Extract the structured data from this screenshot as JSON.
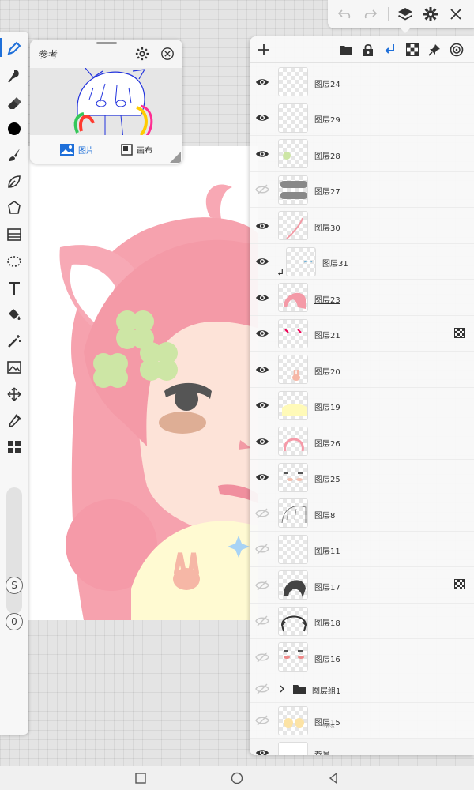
{
  "reference": {
    "title": "参考",
    "tab_image": "图片",
    "tab_canvas": "画布"
  },
  "colors": {
    "accent": "#1e6fd9",
    "eye_visible": "#333333",
    "eye_hidden": "#c8c8c8",
    "current_color": "#000000"
  },
  "toolbar": {
    "tools": [
      "pen-icon",
      "smudge-icon",
      "eraser-icon",
      "color-swatch",
      "brush-icon",
      "leaf-brush-icon",
      "shape-icon",
      "filter-icon",
      "lasso-icon",
      "text-icon",
      "fill-icon",
      "magic-wand-icon",
      "image-adjust-icon",
      "transform-icon",
      "eyedropper-icon",
      "grid-icon"
    ],
    "size_button": "S",
    "opacity_button": "0"
  },
  "layers": [
    {
      "name": "图层24",
      "visible": true
    },
    {
      "name": "图层29",
      "visible": true
    },
    {
      "name": "图层28",
      "visible": true
    },
    {
      "name": "图层27",
      "visible": false
    },
    {
      "name": "图层30",
      "visible": true
    },
    {
      "name": "图层31",
      "visible": true,
      "clipped": true
    },
    {
      "name": "图层23",
      "visible": true,
      "selected": true
    },
    {
      "name": "图层21",
      "visible": true,
      "alpha_lock": true
    },
    {
      "name": "图层20",
      "visible": true
    },
    {
      "name": "图层19",
      "visible": true
    },
    {
      "name": "图层26",
      "visible": true
    },
    {
      "name": "图层25",
      "visible": true
    },
    {
      "name": "图层8",
      "visible": false
    },
    {
      "name": "图层11",
      "visible": false
    },
    {
      "name": "图层17",
      "visible": false,
      "alpha_lock": true
    },
    {
      "name": "图层18",
      "visible": false
    },
    {
      "name": "图层16",
      "visible": false
    },
    {
      "name": "图层组1",
      "visible": false,
      "group": true
    },
    {
      "name": "图层15",
      "visible": false,
      "sub": "56%"
    },
    {
      "name": "背景",
      "visible": true,
      "background": true
    }
  ],
  "layer_panel_icons": [
    "add-layer-icon",
    "folder-icon",
    "lock-icon",
    "clip-icon",
    "alpha-lock-icon",
    "pin-icon",
    "target-icon"
  ],
  "topbar_icons": [
    "undo-icon",
    "redo-icon",
    "layers-icon",
    "settings-icon",
    "close-icon"
  ]
}
